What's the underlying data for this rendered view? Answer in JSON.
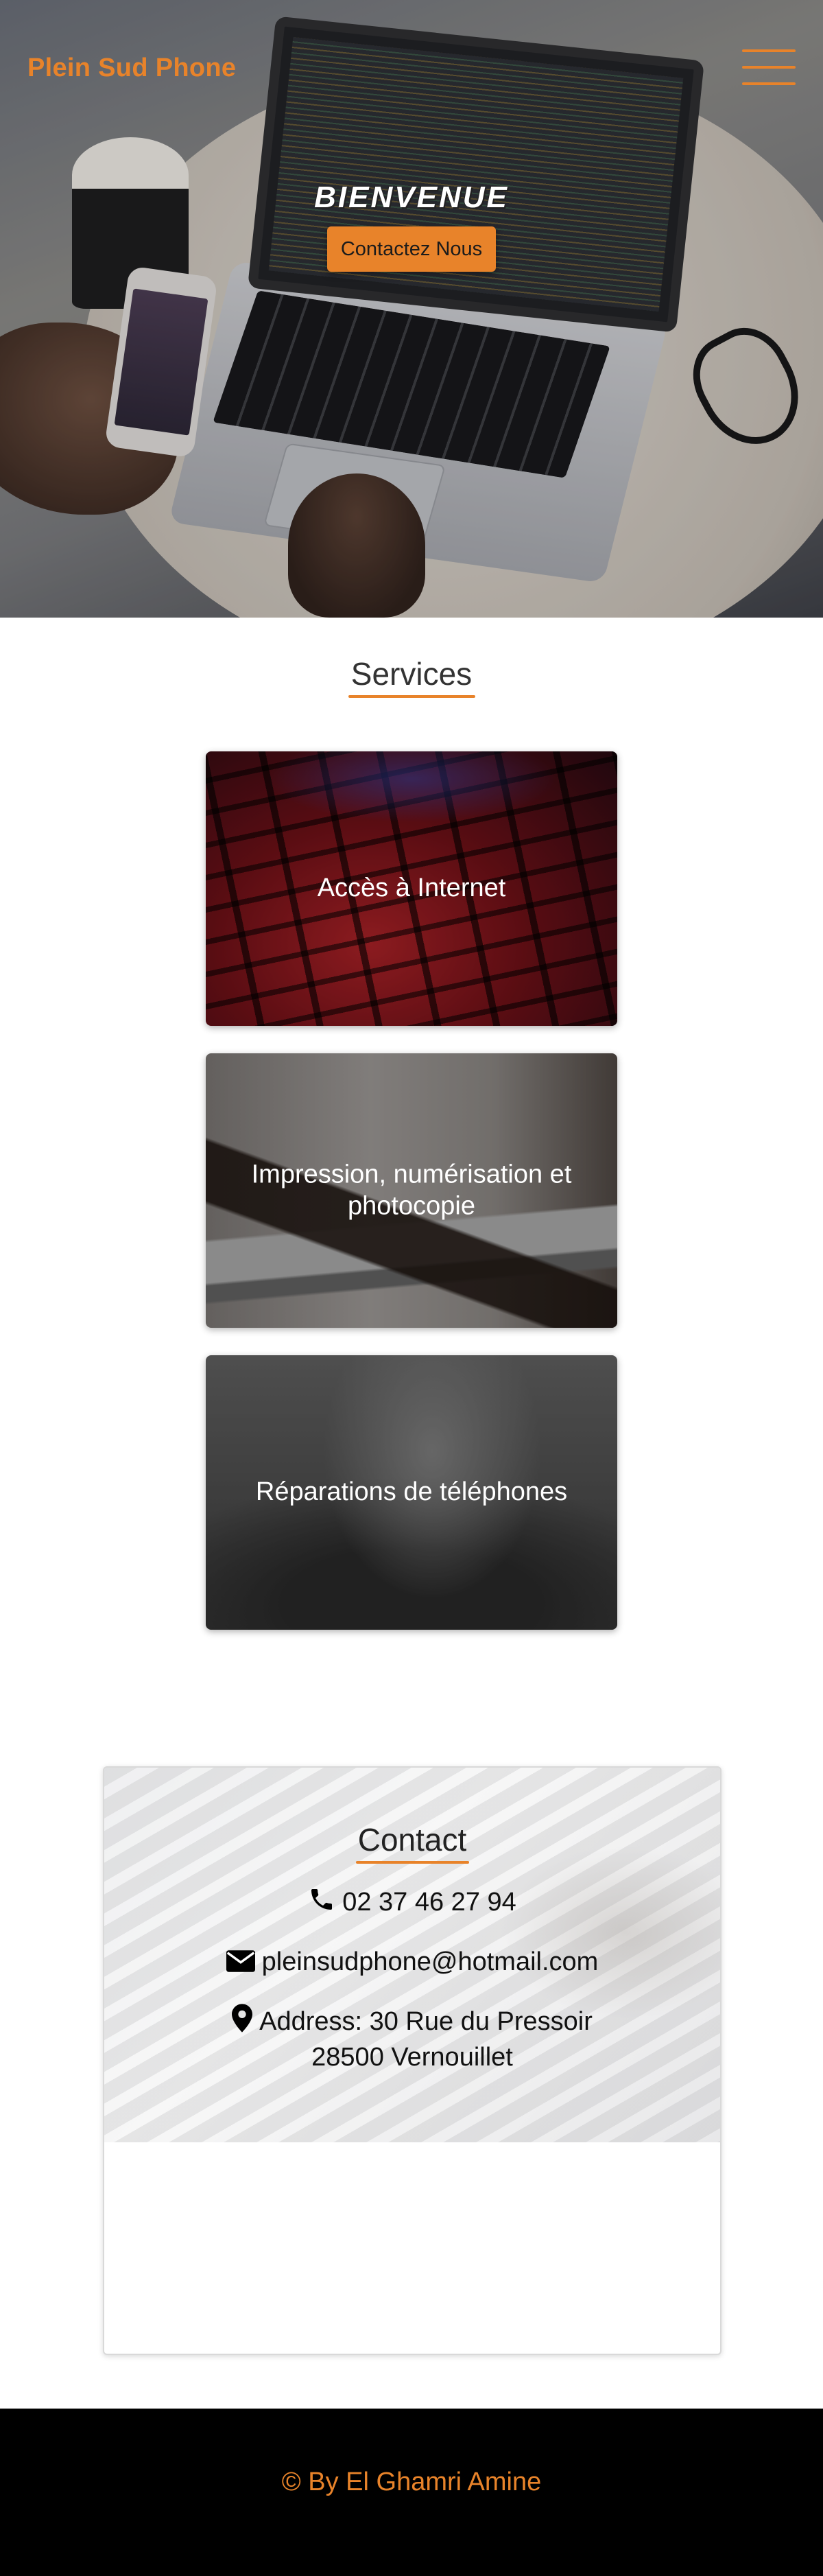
{
  "header": {
    "brand": "Plein Sud Phone",
    "menu_icon": "hamburger-menu-icon"
  },
  "hero": {
    "welcome": "BIENVENUE",
    "cta_label": "Contactez Nous"
  },
  "services": {
    "title": "Services",
    "cards": [
      {
        "label": "Accès à Internet"
      },
      {
        "label": "Impression, numérisation et photocopie"
      },
      {
        "label": "Réparations de téléphones"
      }
    ]
  },
  "contact": {
    "title": "Contact",
    "phone": "02 37 46 27 94",
    "email": "pleinsudphone@hotmail.com",
    "address_line1": "Address: 30 Rue du Pressoir",
    "address_line2": "28500 Vernouillet",
    "icons": [
      "phone-icon",
      "envelope-icon",
      "map-marker-icon"
    ]
  },
  "footer": {
    "copyright": "© By El Ghamri Amine"
  },
  "colors": {
    "accent": "#e8832a",
    "footer_bg": "#000000"
  }
}
